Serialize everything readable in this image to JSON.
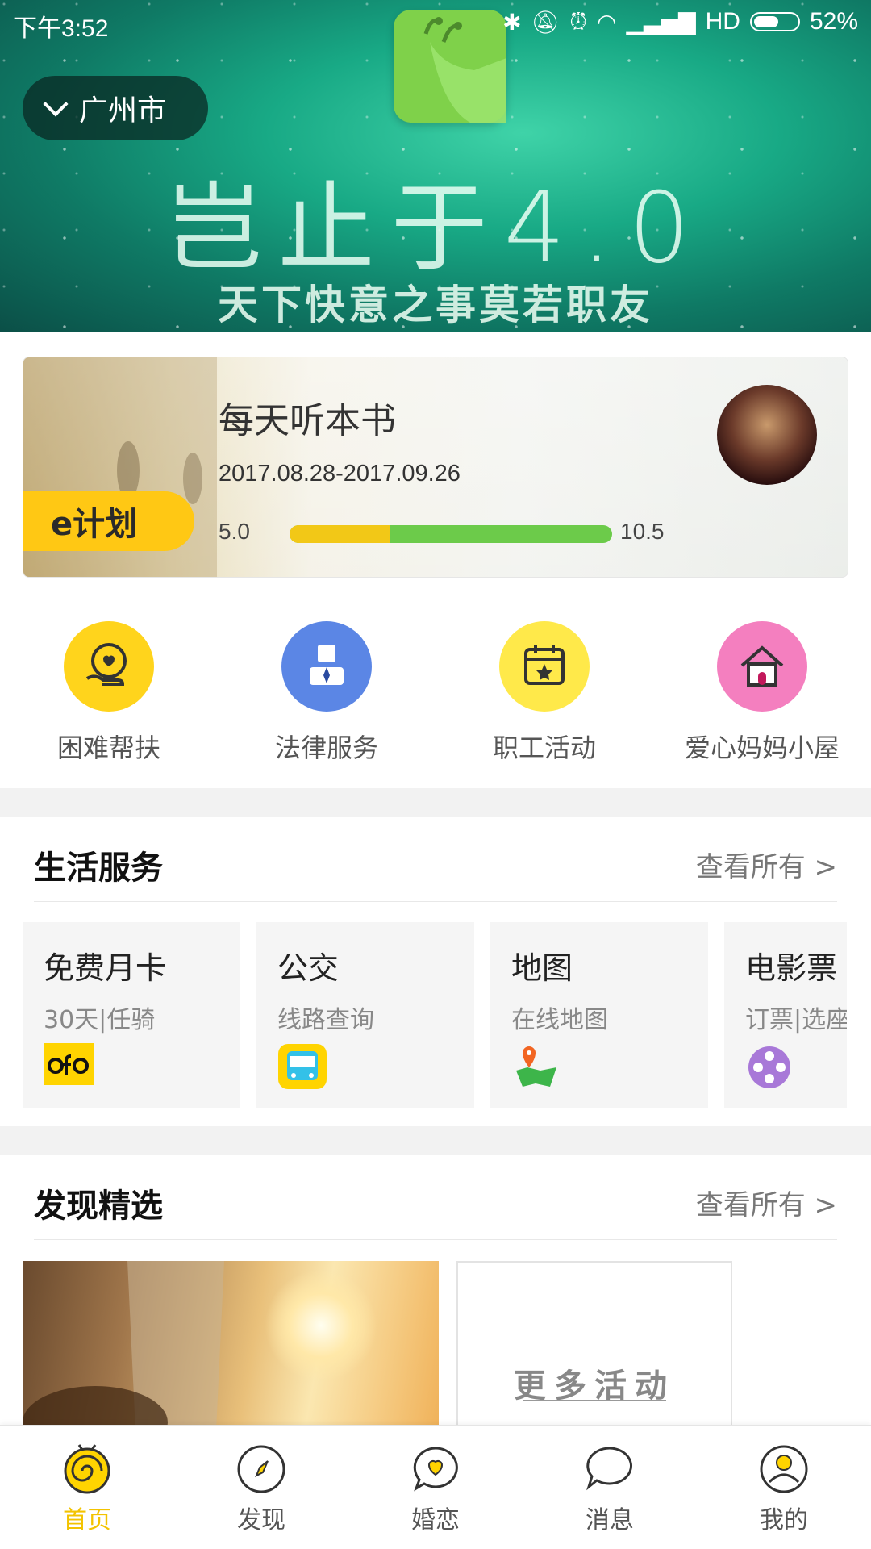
{
  "status_bar": {
    "time": "下午3:52",
    "network": "HD",
    "battery": "52%"
  },
  "banner": {
    "city": "广州市",
    "title": "岂止于4.0",
    "subtitle": "天下快意之事莫若职友"
  },
  "plan_card": {
    "title": "每天听本书",
    "dates": "2017.08.28-2017.09.26",
    "badge": "e计划",
    "min": "5.0",
    "max": "10.5",
    "progress_fraction": 0.31
  },
  "quick_actions": [
    {
      "label": "困难帮扶",
      "icon": "heart-hand-icon",
      "color": "#ffd41c"
    },
    {
      "label": "法律服务",
      "icon": "lawyer-icon",
      "color": "#5b86e5"
    },
    {
      "label": "职工活动",
      "icon": "calendar-star-icon",
      "color": "#ffe94a"
    },
    {
      "label": "爱心妈妈小屋",
      "icon": "house-icon",
      "color": "#f47fbf"
    }
  ],
  "life_services": {
    "title": "生活服务",
    "more": "查看所有 >",
    "cards": [
      {
        "title": "免费月卡",
        "sub": "30天|任骑",
        "icon": "ofo-logo"
      },
      {
        "title": "公交",
        "sub": "线路查询",
        "icon": "bus-icon"
      },
      {
        "title": "地图",
        "sub": "在线地图",
        "icon": "map-icon"
      },
      {
        "title": "电影票",
        "sub": "订票|选座",
        "icon": "film-reel-icon"
      }
    ]
  },
  "discover": {
    "title": "发现精选",
    "more": "查看所有 >",
    "more_card_text": "更多活动"
  },
  "tabbar": [
    {
      "label": "首页",
      "active": true
    },
    {
      "label": "发现",
      "active": false
    },
    {
      "label": "婚恋",
      "active": false
    },
    {
      "label": "消息",
      "active": false
    },
    {
      "label": "我的",
      "active": false
    }
  ],
  "colors": {
    "accent": "#f3c300",
    "banner": "#18a985"
  }
}
